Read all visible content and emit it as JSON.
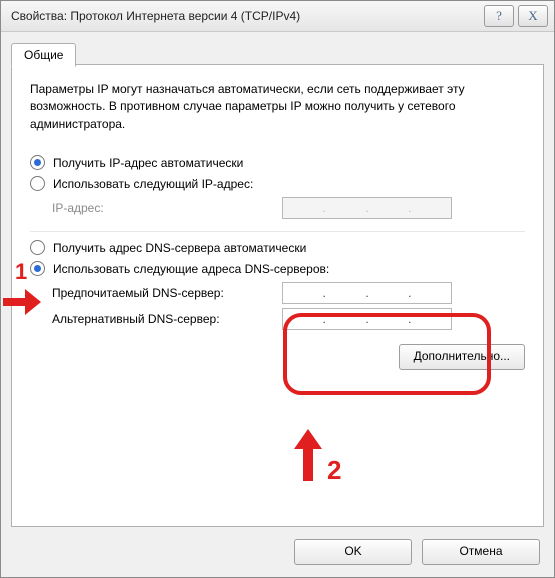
{
  "window": {
    "title": "Свойства: Протокол Интернета версии 4 (TCP/IPv4)"
  },
  "tabs": {
    "general": "Общие"
  },
  "desc": "Параметры IP могут назначаться автоматически, если сеть поддерживает эту возможность. В противном случае параметры IP можно получить у сетевого администратора.",
  "ip": {
    "auto": "Получить IP-адрес автоматически",
    "manual": "Использовать следующий IP-адрес:",
    "addr_label": "IP-адрес:"
  },
  "dns": {
    "auto": "Получить адрес DNS-сервера автоматически",
    "manual": "Использовать следующие адреса DNS-серверов:",
    "pref_label": "Предпочитаемый DNS-сервер:",
    "alt_label": "Альтернативный DNS-сервер:"
  },
  "buttons": {
    "advanced": "Дополнительно...",
    "ok": "OK",
    "cancel": "Отмена"
  },
  "annotations": {
    "n1": "1",
    "n2": "2"
  },
  "titlebar": {
    "help": "?",
    "close": "X"
  },
  "ip_dots": "."
}
